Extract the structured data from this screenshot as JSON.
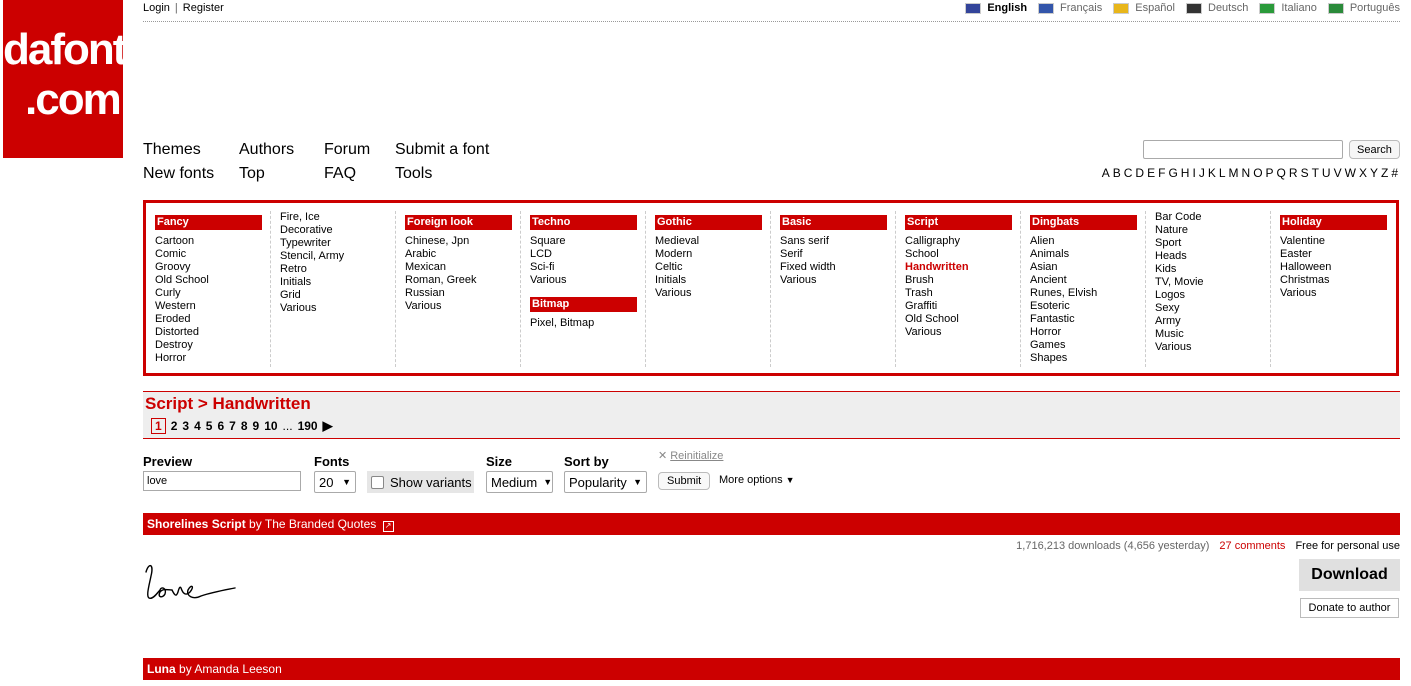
{
  "logo": {
    "line1": "dafont",
    "line2": ".com"
  },
  "top": {
    "login": "Login",
    "separator": "|",
    "register": "Register"
  },
  "languages": [
    {
      "label": "English",
      "active": true,
      "flag": "#33449a"
    },
    {
      "label": "Français",
      "active": false,
      "flag": "#3355aa"
    },
    {
      "label": "Español",
      "active": false,
      "flag": "#e8b61b"
    },
    {
      "label": "Deutsch",
      "active": false,
      "flag": "#333333"
    },
    {
      "label": "Italiano",
      "active": false,
      "flag": "#2a9a3a"
    },
    {
      "label": "Português",
      "active": false,
      "flag": "#2a8a3a"
    }
  ],
  "nav": {
    "themes": "Themes",
    "authors": "Authors",
    "forum": "Forum",
    "submit": "Submit a font",
    "newfonts": "New fonts",
    "top": "Top",
    "faq": "FAQ",
    "tools": "Tools"
  },
  "search": {
    "button": "Search",
    "value": ""
  },
  "alphabet": [
    "A",
    "B",
    "C",
    "D",
    "E",
    "F",
    "G",
    "H",
    "I",
    "J",
    "K",
    "L",
    "M",
    "N",
    "O",
    "P",
    "Q",
    "R",
    "S",
    "T",
    "U",
    "V",
    "W",
    "X",
    "Y",
    "Z",
    "#"
  ],
  "categories": [
    {
      "heads": [
        {
          "title": "Fancy",
          "items": [
            "Cartoon",
            "Comic",
            "Groovy",
            "Old School",
            "Curly",
            "Western",
            "Eroded",
            "Distorted",
            "Destroy",
            "Horror"
          ]
        }
      ]
    },
    {
      "heads": [
        {
          "title": "",
          "items": [
            "Fire, Ice",
            "Decorative",
            "Typewriter",
            "Stencil, Army",
            "Retro",
            "Initials",
            "Grid",
            "Various"
          ]
        }
      ]
    },
    {
      "heads": [
        {
          "title": "Foreign look",
          "items": [
            "Chinese, Jpn",
            "Arabic",
            "Mexican",
            "Roman, Greek",
            "Russian",
            "Various"
          ]
        }
      ]
    },
    {
      "heads": [
        {
          "title": "Techno",
          "items": [
            "Square",
            "LCD",
            "Sci-fi",
            "Various"
          ]
        },
        {
          "title": "Bitmap",
          "items": [
            "Pixel, Bitmap"
          ]
        }
      ]
    },
    {
      "heads": [
        {
          "title": "Gothic",
          "items": [
            "Medieval",
            "Modern",
            "Celtic",
            "Initials",
            "Various"
          ]
        }
      ]
    },
    {
      "heads": [
        {
          "title": "Basic",
          "items": [
            "Sans serif",
            "Serif",
            "Fixed width",
            "Various"
          ]
        }
      ]
    },
    {
      "heads": [
        {
          "title": "Script",
          "items": [
            "Calligraphy",
            "School",
            "Handwritten",
            "Brush",
            "Trash",
            "Graffiti",
            "Old School",
            "Various"
          ]
        }
      ]
    },
    {
      "heads": [
        {
          "title": "Dingbats",
          "items": [
            "Alien",
            "Animals",
            "Asian",
            "Ancient",
            "Runes, Elvish",
            "Esoteric",
            "Fantastic",
            "Horror",
            "Games",
            "Shapes"
          ]
        }
      ]
    },
    {
      "heads": [
        {
          "title": "",
          "items": [
            "Bar Code",
            "Nature",
            "Sport",
            "Heads",
            "Kids",
            "TV, Movie",
            "Logos",
            "Sexy",
            "Army",
            "Music",
            "Various"
          ]
        }
      ]
    },
    {
      "heads": [
        {
          "title": "Holiday",
          "items": [
            "Valentine",
            "Easter",
            "Halloween",
            "Christmas",
            "Various"
          ]
        }
      ]
    }
  ],
  "active_category": "Handwritten",
  "breadcrumb": "Script > Handwritten",
  "pagination": {
    "current": "1",
    "pages": [
      "2",
      "3",
      "4",
      "5",
      "6",
      "7",
      "8",
      "9",
      "10"
    ],
    "ellipsis": "...",
    "last": "190"
  },
  "filters": {
    "preview_label": "Preview",
    "preview_value": "love",
    "fonts_label": "Fonts",
    "fonts_value": "20",
    "variants_label": "Show variants",
    "size_label": "Size",
    "size_value": "Medium",
    "sort_label": "Sort by",
    "sort_value": "Popularity",
    "reinit": "Reinitialize",
    "submit": "Submit",
    "more": "More options"
  },
  "fonts": [
    {
      "name": "Shorelines Script",
      "by": "by",
      "author": "The Branded Quotes",
      "downloads": "1,716,213 downloads (4,656 yesterday)",
      "comments": "27 comments",
      "license": "Free for personal use",
      "download": "Download",
      "donate": "Donate to author",
      "sample": "love"
    },
    {
      "name": "Luna",
      "by": "by",
      "author": "Amanda Leeson"
    }
  ],
  "colors": {
    "brand": "#cc0000"
  }
}
